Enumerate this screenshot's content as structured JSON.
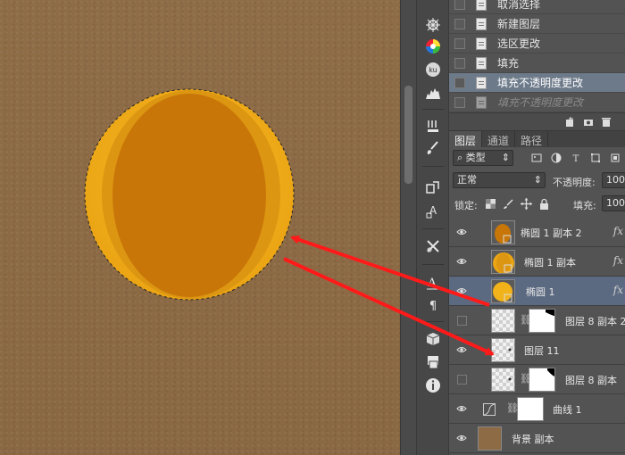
{
  "history": {
    "items": [
      {
        "label": "取消选择",
        "state": "normal"
      },
      {
        "label": "新建图层",
        "state": "normal"
      },
      {
        "label": "选区更改",
        "state": "normal"
      },
      {
        "label": "填充",
        "state": "normal"
      },
      {
        "label": "填充不透明度更改",
        "state": "active"
      },
      {
        "label": "填充不透明度更改",
        "state": "undone"
      }
    ]
  },
  "layers_panel": {
    "tabs": [
      {
        "label": "图层",
        "active": true
      },
      {
        "label": "通道",
        "active": false
      },
      {
        "label": "路径",
        "active": false
      }
    ],
    "filter_kind": "类型",
    "blend_mode": "正常",
    "opacity_label": "不透明度:",
    "opacity_value": "100%",
    "lock_label": "锁定:",
    "fill_label": "填充:",
    "fill_value": "100%",
    "fx_label": "fx",
    "layers": [
      {
        "name": "椭圆 1 副本 2",
        "visible": true,
        "selected": false,
        "type": "shape"
      },
      {
        "name": "椭圆 1 副本",
        "visible": true,
        "selected": false,
        "type": "shape"
      },
      {
        "name": "椭圆 1",
        "visible": true,
        "selected": true,
        "type": "shape"
      },
      {
        "name": "图层 8 副本 2",
        "visible": false,
        "selected": false,
        "type": "masked"
      },
      {
        "name": "图层 11",
        "visible": true,
        "selected": false,
        "type": "pixel"
      },
      {
        "name": "图层 8 副本",
        "visible": false,
        "selected": false,
        "type": "masked"
      },
      {
        "name": "曲线 1",
        "visible": true,
        "selected": false,
        "type": "adjustment"
      },
      {
        "name": "背景 副本",
        "visible": true,
        "selected": false,
        "type": "fill"
      }
    ]
  },
  "tools": [
    "compass-icon",
    "color-wheel-icon",
    "kuler-icon",
    "histogram-icon",
    "brush-presets-icon",
    "brush-icon",
    "clone-source-icon",
    "adjust-icon",
    "tool-presets-icon",
    "character-icon",
    "paragraph-icon",
    "3d-icon",
    "layer-comps-icon",
    "info-icon"
  ],
  "colors": {
    "canvas_bg": "#8c6b45",
    "ball_outer": "#f2b21a",
    "ball_mid": "#e39a12",
    "ball_core": "#c87608",
    "arrow": "#ff1a1a",
    "selected_layer": "#5b6a80",
    "active_history": "#6d7a8a"
  }
}
